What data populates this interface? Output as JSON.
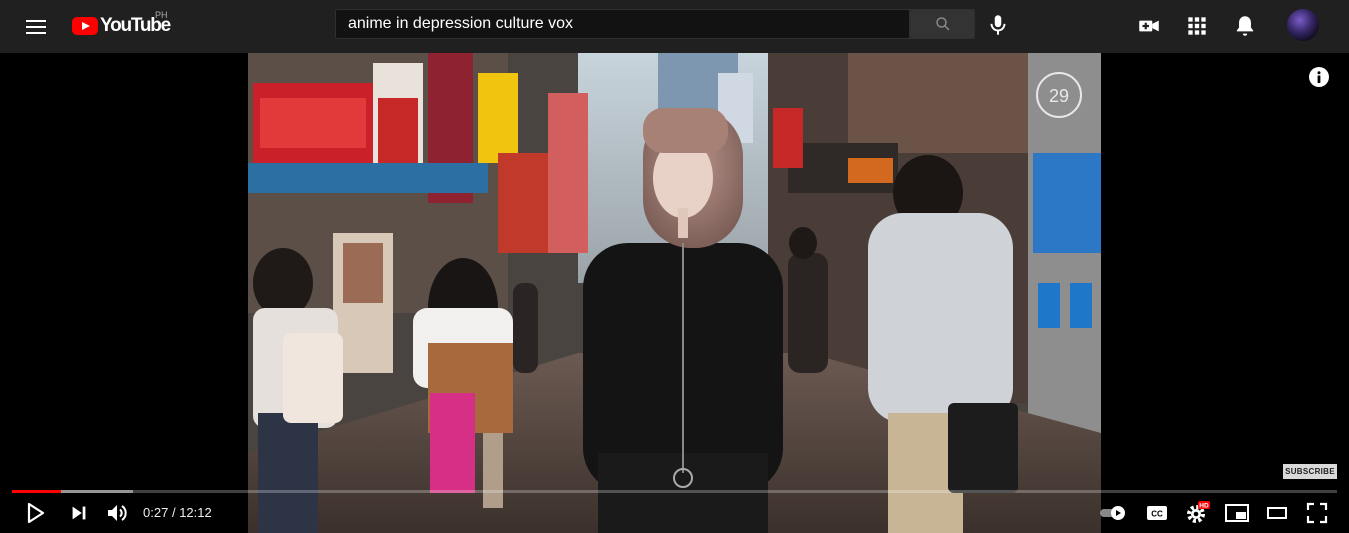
{
  "header": {
    "logo_text": "YouTube",
    "country_code": "PH",
    "search": {
      "value": "anime in depression culture vox"
    }
  },
  "player": {
    "current_time": "0:27",
    "separator": "/",
    "duration": "12:12",
    "played_fraction": 0.037,
    "buffered_fraction": 0.091,
    "subscribe_label": "SUBSCRIBE",
    "quality_badge": "HD",
    "channel_watermark": "29",
    "cc_label": "CC"
  },
  "colors": {
    "brand_red": "#ff0000",
    "topbar_bg": "#202020",
    "progress_red": "#ff0000"
  },
  "icons": [
    "menu-icon",
    "youtube-logo-icon",
    "search-icon",
    "microphone-icon",
    "create-video-icon",
    "apps-grid-icon",
    "notifications-bell-icon",
    "info-icon",
    "play-icon",
    "next-icon",
    "volume-icon",
    "autoplay-toggle-icon",
    "captions-icon",
    "settings-gear-icon",
    "miniplayer-icon",
    "theater-mode-icon",
    "fullscreen-icon"
  ]
}
